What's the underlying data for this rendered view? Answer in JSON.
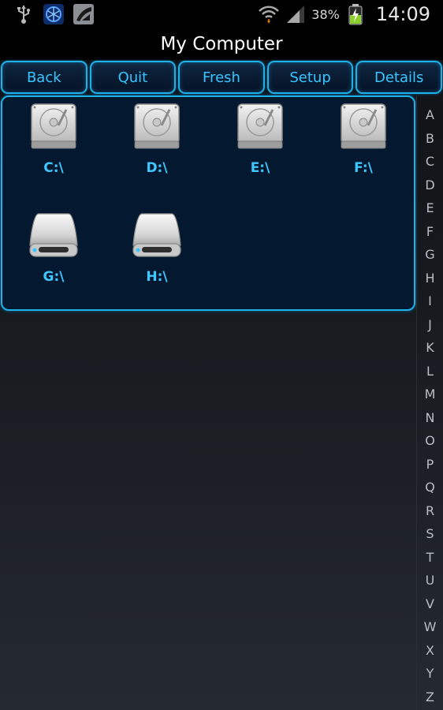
{
  "status_bar": {
    "battery_percent": "38%",
    "time": "14:09"
  },
  "header": {
    "title": "My Computer"
  },
  "toolbar": {
    "buttons": [
      {
        "label": "Back"
      },
      {
        "label": "Quit"
      },
      {
        "label": "Fresh"
      },
      {
        "label": "Setup"
      },
      {
        "label": "Details"
      }
    ]
  },
  "drives": [
    {
      "label": "C:\\",
      "icon": "hard-disk-icon"
    },
    {
      "label": "D:\\",
      "icon": "hard-disk-icon"
    },
    {
      "label": "E:\\",
      "icon": "hard-disk-icon"
    },
    {
      "label": "F:\\",
      "icon": "hard-disk-icon"
    },
    {
      "label": "G:\\",
      "icon": "removable-drive-icon"
    },
    {
      "label": "H:\\",
      "icon": "removable-drive-icon"
    }
  ],
  "alphabet_index": [
    "A",
    "B",
    "C",
    "D",
    "E",
    "F",
    "G",
    "H",
    "I",
    "J",
    "K",
    "L",
    "M",
    "N",
    "O",
    "P",
    "Q",
    "R",
    "S",
    "T",
    "U",
    "V",
    "W",
    "X",
    "Y",
    "Z"
  ],
  "colors": {
    "accent": "#1fb2e8",
    "label_text": "#3ec8ff",
    "panel_bg": "#041830"
  }
}
